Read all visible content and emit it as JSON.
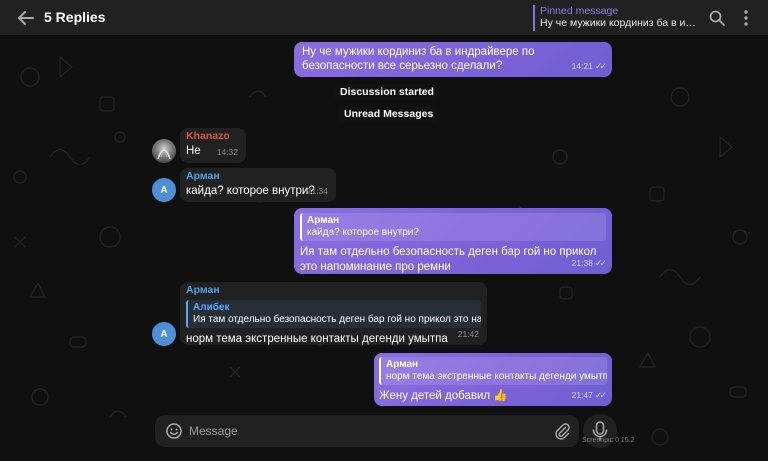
{
  "header": {
    "title": "5 Replies",
    "pinned_label": "Pinned message",
    "pinned_text": "Ну че мужики кординиз ба в индрайвере по безопасности все серьезно сделали?"
  },
  "messages": [
    {
      "text": "Ну че мужики кординиз ба в индрайвере по безопасности все серьезно сделали?",
      "time": "14:21"
    },
    {
      "service": "Discussion started"
    },
    {
      "service": "Unread Messages"
    },
    {
      "sender": "Khanazo",
      "text": "Не",
      "time": "14:32"
    },
    {
      "sender": "Арман",
      "avatar_letter": "А",
      "text": "кайда? которое внутри?",
      "time": "21:34"
    },
    {
      "quote_name": "Арман",
      "quote_text": "кайда? которое внутри?",
      "text": "Ия там отдельно безопасность деген бар гой но прикол это напоминание про ремни",
      "time": "21:38"
    },
    {
      "sender": "Арман",
      "avatar_letter": "А",
      "quote_name": "Алибек",
      "quote_text": "Ия там отдельно безопасность деген бар гой но прикол это нап...",
      "text": "норм тема экстренные контакты дегенди умытпа",
      "time": "21:42"
    },
    {
      "quote_name": "Арман",
      "quote_text": "норм тема экстренные контакты дегенди умытпа",
      "text": "Жену детей добавил 👍",
      "time": "21:47"
    }
  ],
  "composer": {
    "placeholder": "Message"
  },
  "watermark": "Screenpic 0.15.2",
  "colors": {
    "accent": "#8774e1",
    "name_blue": "#4fa3e3",
    "bg": "#0f0f0f",
    "bubble_in": "#212121"
  }
}
